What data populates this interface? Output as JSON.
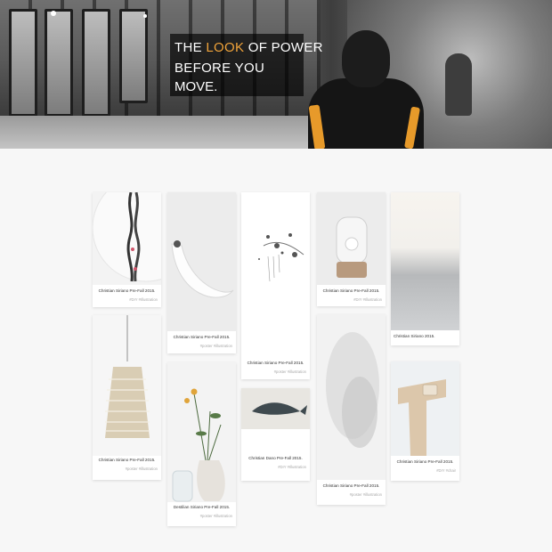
{
  "hero": {
    "word_the": "THE",
    "word_look": "LOOK",
    "rest_line1": "OF POWER",
    "line2": "BEFORE YOU",
    "line3": "MOVE.",
    "accent_color": "#f0a33a"
  },
  "cards": [
    {
      "title": "Christian Siriano Pre-Fall 2015.",
      "tags": "#DIY #Illustration"
    },
    {
      "title": "Christian Siriano Pre-Fall 2015.",
      "tags": "#poster #illustration"
    },
    {
      "title": "Christian Siriano Pre-Fall 2015.",
      "tags": "#poster #illustration"
    },
    {
      "title": "Christian Siriano Pre-Fall 2015.",
      "tags": "#DIY #Illustration"
    },
    {
      "title": "Christian Siriano 2015.",
      "tags": ""
    },
    {
      "title": "Christian Siriano Pre-Fall 2015.",
      "tags": "#poster #illustration"
    },
    {
      "title": "Destilian Siriano Pre-Fall 2015.",
      "tags": "#poster #illustration"
    },
    {
      "title": "Christian Dano Pre-Fall 2015.",
      "tags": "#DIY #Illustration"
    },
    {
      "title": "Christian Siriano Pre-Fall 2015.",
      "tags": "#poster #illustration"
    },
    {
      "title": "Christian Siriano Pre-Fall 2015.",
      "tags": "#DIY #chair"
    }
  ]
}
